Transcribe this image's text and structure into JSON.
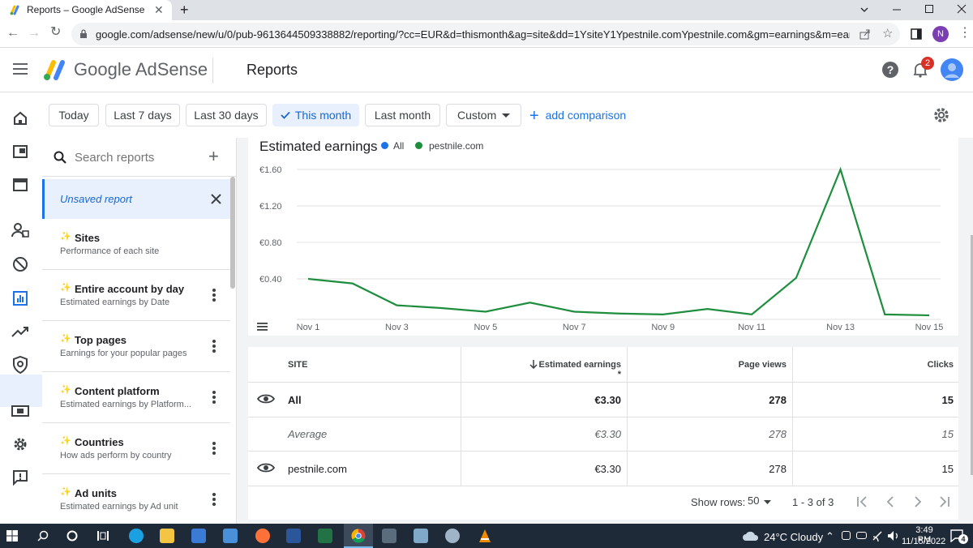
{
  "browser": {
    "tab_title": "Reports – Google AdSense",
    "url": "google.com/adsense/new/u/0/pub-9613644509338882/reporting/?cc=EUR&d=thismonth&ag=site&dd=1YsiteY1Ypestnile.comYpestnile.com&gm=earnings&m=earnings%...",
    "profile_initial": "N"
  },
  "header": {
    "brand": "Google AdSense",
    "page_title": "Reports",
    "notification_count": "2"
  },
  "date_filters": {
    "today": "Today",
    "last7": "Last 7 days",
    "last30": "Last 30 days",
    "this_month": "This month",
    "last_month": "Last month",
    "custom": "Custom",
    "add_comparison": "add comparison"
  },
  "reports_panel": {
    "search_placeholder": "Search reports",
    "unsaved": "Unsaved report",
    "items": [
      {
        "name": "Sites",
        "desc": "Performance of each site"
      },
      {
        "name": "Entire account by day",
        "desc": "Estimated earnings by Date"
      },
      {
        "name": "Top pages",
        "desc": "Earnings for your popular pages"
      },
      {
        "name": "Content platform",
        "desc": "Estimated earnings by Platform..."
      },
      {
        "name": "Countries",
        "desc": "How ads perform by country"
      },
      {
        "name": "Ad units",
        "desc": "Estimated earnings by Ad unit"
      }
    ]
  },
  "chart_data": {
    "type": "line",
    "title": "Estimated earnings",
    "legend": [
      "All",
      "pestnile.com"
    ],
    "legend_colors": [
      "#1a73e8",
      "#1e8e3e"
    ],
    "series_color": "#1e8e3e",
    "x": [
      "Nov 1",
      "Nov 2",
      "Nov 3",
      "Nov 4",
      "Nov 5",
      "Nov 6",
      "Nov 7",
      "Nov 8",
      "Nov 9",
      "Nov 10",
      "Nov 11",
      "Nov 12",
      "Nov 13",
      "Nov 14",
      "Nov 15"
    ],
    "x_tick_labels": [
      "Nov 1",
      "Nov 3",
      "Nov 5",
      "Nov 7",
      "Nov 9",
      "Nov 11",
      "Nov 13",
      "Nov 15"
    ],
    "y_tick_labels": [
      "€1.60",
      "€1.20",
      "€0.80",
      "€0.40"
    ],
    "ylim": [
      0,
      1.6
    ],
    "values": [
      0.4,
      0.35,
      0.11,
      0.08,
      0.04,
      0.14,
      0.04,
      0.02,
      0.01,
      0.07,
      0.01,
      0.41,
      1.6,
      0.01,
      0.0
    ],
    "grid": true
  },
  "table": {
    "headers": {
      "site": "SITE",
      "earnings": "Estimated earnings *",
      "pageviews": "Page views",
      "clicks": "Clicks"
    },
    "rows": [
      {
        "site": "All",
        "earnings": "€3.30",
        "pageviews": "278",
        "clicks": "15"
      },
      {
        "site": "Average",
        "earnings": "€3.30",
        "pageviews": "278",
        "clicks": "15"
      },
      {
        "site": "pestnile.com",
        "earnings": "€3.30",
        "pageviews": "278",
        "clicks": "15"
      }
    ],
    "show_rows_label": "Show rows:",
    "show_rows_value": "50",
    "range": "1 - 3 of 3"
  },
  "taskbar": {
    "weather": "24°C  Cloudy",
    "time": "3:49 PM",
    "date": "11/15/2022",
    "notif_badge": "4"
  }
}
